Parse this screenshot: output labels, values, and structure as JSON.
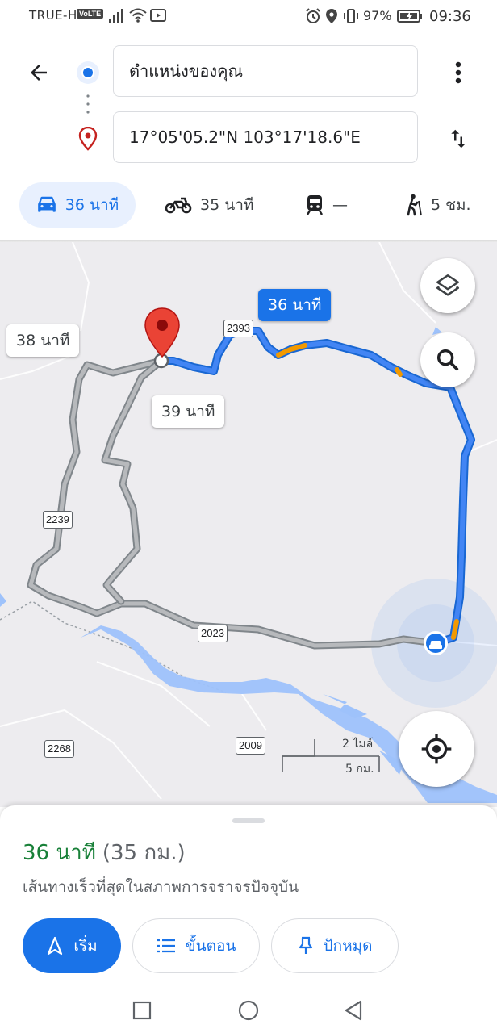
{
  "status_bar": {
    "carrier": "TRUE-H",
    "volte": "VoLTE",
    "battery": "97%",
    "time": "09:36"
  },
  "directions": {
    "origin": "ตำแหน่งของคุณ",
    "destination": "17°05'05.2\"N 103°17'18.6\"E",
    "modes": [
      {
        "name": "drive",
        "label": "36 นาที",
        "active": true
      },
      {
        "name": "motorcycle",
        "label": "35 นาที",
        "active": false
      },
      {
        "name": "transit",
        "label": "—",
        "active": false
      },
      {
        "name": "walk",
        "label": "5 ชม.",
        "active": false
      }
    ]
  },
  "map": {
    "route_callouts": {
      "main": "36 นาที",
      "alt1": "38 นาที",
      "alt2": "39 นาที"
    },
    "road_signs": [
      "2393",
      "2239",
      "2023",
      "2268",
      "2009"
    ],
    "scale": {
      "miles": "2 ไมล์",
      "km": "5 กม."
    },
    "colors": {
      "route_primary": "#4285f4",
      "route_primary_edge": "#1967d2",
      "route_alt": "#b7b9bc",
      "traffic_slow": "#f29900",
      "water": "#9ec2fb",
      "pin": "#ea4335"
    }
  },
  "sheet": {
    "eta": "36 นาที",
    "distance": "(35 กม.)",
    "description": "เส้นทางเร็วที่สุดในสภาพการจราจรปัจจุบัน",
    "start_label": "เริ่ม",
    "steps_label": "ขั้นตอน",
    "pin_label": "ปักหมุด"
  }
}
